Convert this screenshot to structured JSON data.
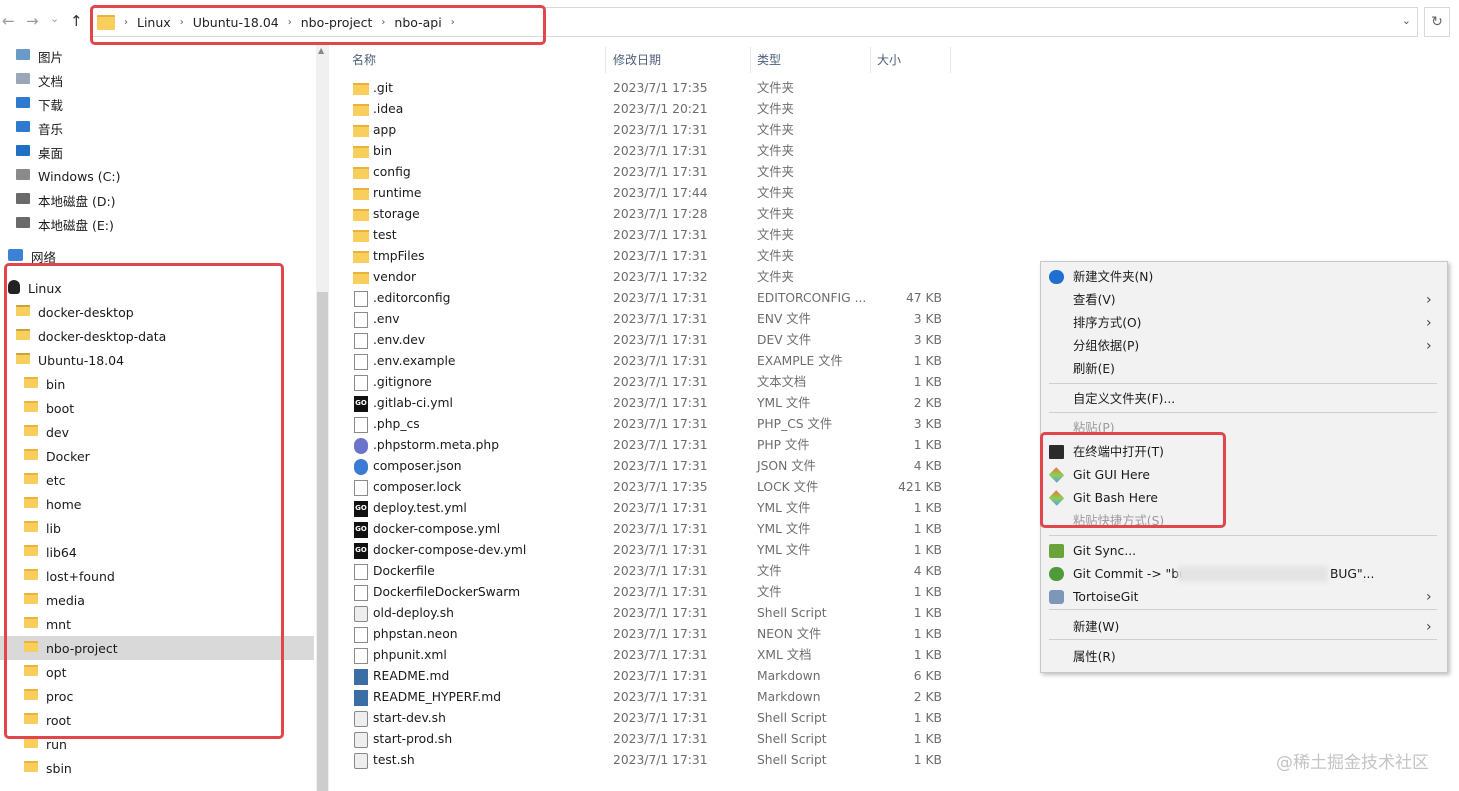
{
  "breadcrumb": [
    "Linux",
    "Ubuntu-18.04",
    "nbo-project",
    "nbo-api"
  ],
  "nav": {
    "back": "←",
    "forward": "→",
    "recent": "⌄",
    "up": "↑",
    "refresh": "↻"
  },
  "columns": {
    "name": "名称",
    "date": "修改日期",
    "type": "类型",
    "size": "大小"
  },
  "sidebar": {
    "quick": [
      "图片",
      "文档",
      "下载",
      "音乐",
      "桌面",
      "Windows (C:)",
      "本地磁盘 (D:)",
      "本地磁盘 (E:)"
    ],
    "network": "网络",
    "linux": "Linux",
    "linux_children": [
      "docker-desktop",
      "docker-desktop-data",
      "Ubuntu-18.04"
    ],
    "ubuntu_children": [
      "bin",
      "boot",
      "dev",
      "Docker",
      "etc",
      "home",
      "lib",
      "lib64",
      "lost+found",
      "media",
      "mnt",
      "nbo-project",
      "opt",
      "proc",
      "root",
      "run",
      "sbin"
    ],
    "selected": "nbo-project"
  },
  "files": [
    {
      "name": ".git",
      "date": "2023/7/1 17:35",
      "type": "文件夹",
      "size": "",
      "icon": "folder"
    },
    {
      "name": ".idea",
      "date": "2023/7/1 20:21",
      "type": "文件夹",
      "size": "",
      "icon": "folder"
    },
    {
      "name": "app",
      "date": "2023/7/1 17:31",
      "type": "文件夹",
      "size": "",
      "icon": "folder"
    },
    {
      "name": "bin",
      "date": "2023/7/1 17:31",
      "type": "文件夹",
      "size": "",
      "icon": "folder"
    },
    {
      "name": "config",
      "date": "2023/7/1 17:31",
      "type": "文件夹",
      "size": "",
      "icon": "folder"
    },
    {
      "name": "runtime",
      "date": "2023/7/1 17:44",
      "type": "文件夹",
      "size": "",
      "icon": "folder"
    },
    {
      "name": "storage",
      "date": "2023/7/1 17:28",
      "type": "文件夹",
      "size": "",
      "icon": "folder"
    },
    {
      "name": "test",
      "date": "2023/7/1 17:31",
      "type": "文件夹",
      "size": "",
      "icon": "folder"
    },
    {
      "name": "tmpFiles",
      "date": "2023/7/1 17:31",
      "type": "文件夹",
      "size": "",
      "icon": "folder"
    },
    {
      "name": "vendor",
      "date": "2023/7/1 17:32",
      "type": "文件夹",
      "size": "",
      "icon": "folder"
    },
    {
      "name": ".editorconfig",
      "date": "2023/7/1 17:31",
      "type": "EDITORCONFIG ...",
      "size": "47 KB",
      "icon": "doc"
    },
    {
      "name": ".env",
      "date": "2023/7/1 17:31",
      "type": "ENV 文件",
      "size": "3 KB",
      "icon": "doc"
    },
    {
      "name": ".env.dev",
      "date": "2023/7/1 17:31",
      "type": "DEV 文件",
      "size": "3 KB",
      "icon": "doc"
    },
    {
      "name": ".env.example",
      "date": "2023/7/1 17:31",
      "type": "EXAMPLE 文件",
      "size": "1 KB",
      "icon": "doc"
    },
    {
      "name": ".gitignore",
      "date": "2023/7/1 17:31",
      "type": "文本文档",
      "size": "1 KB",
      "icon": "doc"
    },
    {
      "name": ".gitlab-ci.yml",
      "date": "2023/7/1 17:31",
      "type": "YML 文件",
      "size": "2 KB",
      "icon": "go"
    },
    {
      "name": ".php_cs",
      "date": "2023/7/1 17:31",
      "type": "PHP_CS 文件",
      "size": "3 KB",
      "icon": "doc"
    },
    {
      "name": ".phpstorm.meta.php",
      "date": "2023/7/1 17:31",
      "type": "PHP 文件",
      "size": "1 KB",
      "icon": "php"
    },
    {
      "name": "composer.json",
      "date": "2023/7/1 17:31",
      "type": "JSON 文件",
      "size": "4 KB",
      "icon": "json"
    },
    {
      "name": "composer.lock",
      "date": "2023/7/1 17:35",
      "type": "LOCK 文件",
      "size": "421 KB",
      "icon": "doc"
    },
    {
      "name": "deploy.test.yml",
      "date": "2023/7/1 17:31",
      "type": "YML 文件",
      "size": "1 KB",
      "icon": "go"
    },
    {
      "name": "docker-compose.yml",
      "date": "2023/7/1 17:31",
      "type": "YML 文件",
      "size": "1 KB",
      "icon": "go"
    },
    {
      "name": "docker-compose-dev.yml",
      "date": "2023/7/1 17:31",
      "type": "YML 文件",
      "size": "1 KB",
      "icon": "go"
    },
    {
      "name": "Dockerfile",
      "date": "2023/7/1 17:31",
      "type": "文件",
      "size": "4 KB",
      "icon": "doc"
    },
    {
      "name": "DockerfileDockerSwarm",
      "date": "2023/7/1 17:31",
      "type": "文件",
      "size": "1 KB",
      "icon": "doc"
    },
    {
      "name": "old-deploy.sh",
      "date": "2023/7/1 17:31",
      "type": "Shell Script",
      "size": "1 KB",
      "icon": "gear"
    },
    {
      "name": "phpstan.neon",
      "date": "2023/7/1 17:31",
      "type": "NEON 文件",
      "size": "1 KB",
      "icon": "doc"
    },
    {
      "name": "phpunit.xml",
      "date": "2023/7/1 17:31",
      "type": "XML 文档",
      "size": "1 KB",
      "icon": "doc"
    },
    {
      "name": "README.md",
      "date": "2023/7/1 17:31",
      "type": "Markdown",
      "size": "6 KB",
      "icon": "md"
    },
    {
      "name": "README_HYPERF.md",
      "date": "2023/7/1 17:31",
      "type": "Markdown",
      "size": "2 KB",
      "icon": "md"
    },
    {
      "name": "start-dev.sh",
      "date": "2023/7/1 17:31",
      "type": "Shell Script",
      "size": "1 KB",
      "icon": "gear"
    },
    {
      "name": "start-prod.sh",
      "date": "2023/7/1 17:31",
      "type": "Shell Script",
      "size": "1 KB",
      "icon": "gear"
    },
    {
      "name": "test.sh",
      "date": "2023/7/1 17:31",
      "type": "Shell Script",
      "size": "1 KB",
      "icon": "gear"
    }
  ],
  "context_menu": [
    {
      "label": "新建文件夹(N)",
      "icon": "new-folder-icon",
      "submenu": false
    },
    {
      "label": "查看(V)",
      "submenu": true
    },
    {
      "label": "排序方式(O)",
      "submenu": true
    },
    {
      "label": "分组依据(P)",
      "submenu": true
    },
    {
      "label": "刷新(E)",
      "submenu": false
    },
    {
      "label": "自定义文件夹(F)...",
      "submenu": false
    },
    {
      "label": "粘贴(P)",
      "disabled": true
    },
    {
      "label": "在终端中打开(T)",
      "icon": "terminal-icon"
    },
    {
      "label": "Git GUI Here",
      "icon": "git-gui-icon"
    },
    {
      "label": "Git Bash Here",
      "icon": "git-bash-icon"
    },
    {
      "label": "粘贴快捷方式(S)",
      "disabled": true
    },
    {
      "label": "Git Sync...",
      "icon": "git-sync-icon"
    },
    {
      "label": "Git Commit -> \"bu",
      "label_end": "BUG\"...",
      "icon": "git-commit-icon"
    },
    {
      "label": "TortoiseGit",
      "icon": "tortoisegit-icon",
      "submenu": true
    },
    {
      "label": "新建(W)",
      "submenu": true
    },
    {
      "label": "属性(R)",
      "submenu": false
    }
  ],
  "watermark": "@稀土掘金技术社区",
  "colors": {
    "highlight_box": "#e0464b",
    "folder": "#f8cf5c",
    "selected_row": "#d9d9d9"
  }
}
